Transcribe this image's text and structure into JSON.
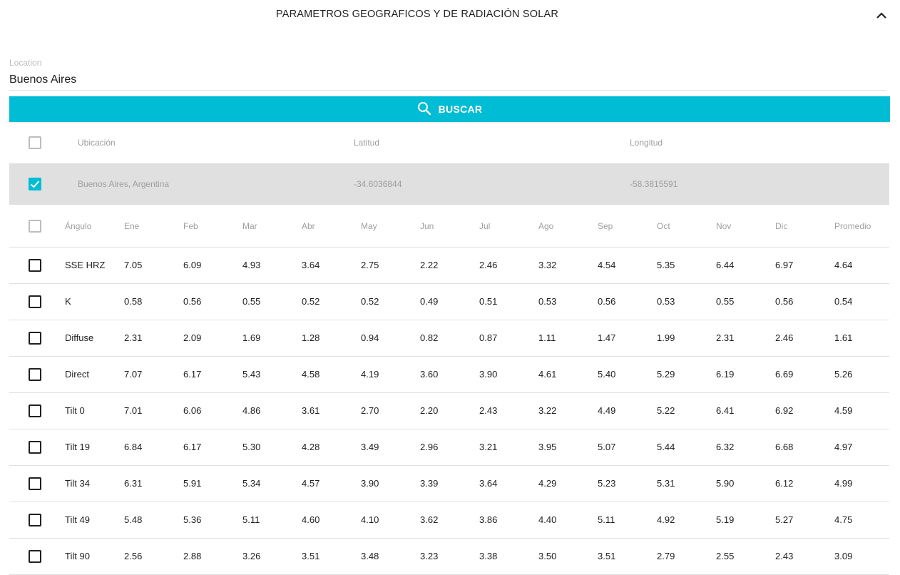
{
  "panel": {
    "title": "PARAMETROS GEOGRAFICOS Y DE RADIACIÓN SOLAR"
  },
  "location": {
    "label": "Location",
    "value": "Buenos Aires"
  },
  "search": {
    "label": "BUSCAR"
  },
  "locations_table": {
    "headers": [
      "Ubicación",
      "Latitud",
      "Longitud"
    ],
    "rows": [
      {
        "name": "Buenos Aires, Argentina",
        "lat": "-34.6036844",
        "lon": "-58.3815591",
        "selected": true
      }
    ]
  },
  "radiation_table": {
    "headers": [
      "Ángulo",
      "Ene",
      "Feb",
      "Mar",
      "Abr",
      "May",
      "Jun",
      "Jul",
      "Ago",
      "Sep",
      "Oct",
      "Nov",
      "Dic",
      "Promedio"
    ],
    "rows": [
      [
        "SSE HRZ",
        "7.05",
        "6.09",
        "4.93",
        "3.64",
        "2.75",
        "2.22",
        "2.46",
        "3.32",
        "4.54",
        "5.35",
        "6.44",
        "6.97",
        "4.64"
      ],
      [
        "K",
        "0.58",
        "0.56",
        "0.55",
        "0.52",
        "0.52",
        "0.49",
        "0.51",
        "0.53",
        "0.56",
        "0.53",
        "0.55",
        "0.56",
        "0.54"
      ],
      [
        "Diffuse",
        "2.31",
        "2.09",
        "1.69",
        "1.28",
        "0.94",
        "0.82",
        "0.87",
        "1.11",
        "1.47",
        "1.99",
        "2.31",
        "2.46",
        "1.61"
      ],
      [
        "Direct",
        "7.07",
        "6.17",
        "5.43",
        "4.58",
        "4.19",
        "3.60",
        "3.90",
        "4.61",
        "5.40",
        "5.29",
        "6.19",
        "6.69",
        "5.26"
      ],
      [
        "Tilt 0",
        "7.01",
        "6.06",
        "4.86",
        "3.61",
        "2.70",
        "2.20",
        "2.43",
        "3.22",
        "4.49",
        "5.22",
        "6.41",
        "6.92",
        "4.59"
      ],
      [
        "Tilt 19",
        "6.84",
        "6.17",
        "5.30",
        "4.28",
        "3.49",
        "2.96",
        "3.21",
        "3.95",
        "5.07",
        "5.44",
        "6.32",
        "6.68",
        "4.97"
      ],
      [
        "Tilt 34",
        "6.31",
        "5.91",
        "5.34",
        "4.57",
        "3.90",
        "3.39",
        "3.64",
        "4.29",
        "5.23",
        "5.31",
        "5.90",
        "6.12",
        "4.99"
      ],
      [
        "Tilt 49",
        "5.48",
        "5.36",
        "5.11",
        "4.60",
        "4.10",
        "3.62",
        "3.86",
        "4.40",
        "5.11",
        "4.92",
        "5.19",
        "5.27",
        "4.75"
      ],
      [
        "Tilt 90",
        "2.56",
        "2.88",
        "3.26",
        "3.51",
        "3.48",
        "3.23",
        "3.38",
        "3.50",
        "3.51",
        "2.79",
        "2.55",
        "2.43",
        "3.09"
      ]
    ]
  },
  "colors": {
    "accent": "#00bcd4",
    "selected_row": "#e0e0e0",
    "muted_text": "#9e9e9e"
  },
  "icons": [
    "chevron-up-icon",
    "search-icon",
    "checkmark-icon"
  ]
}
